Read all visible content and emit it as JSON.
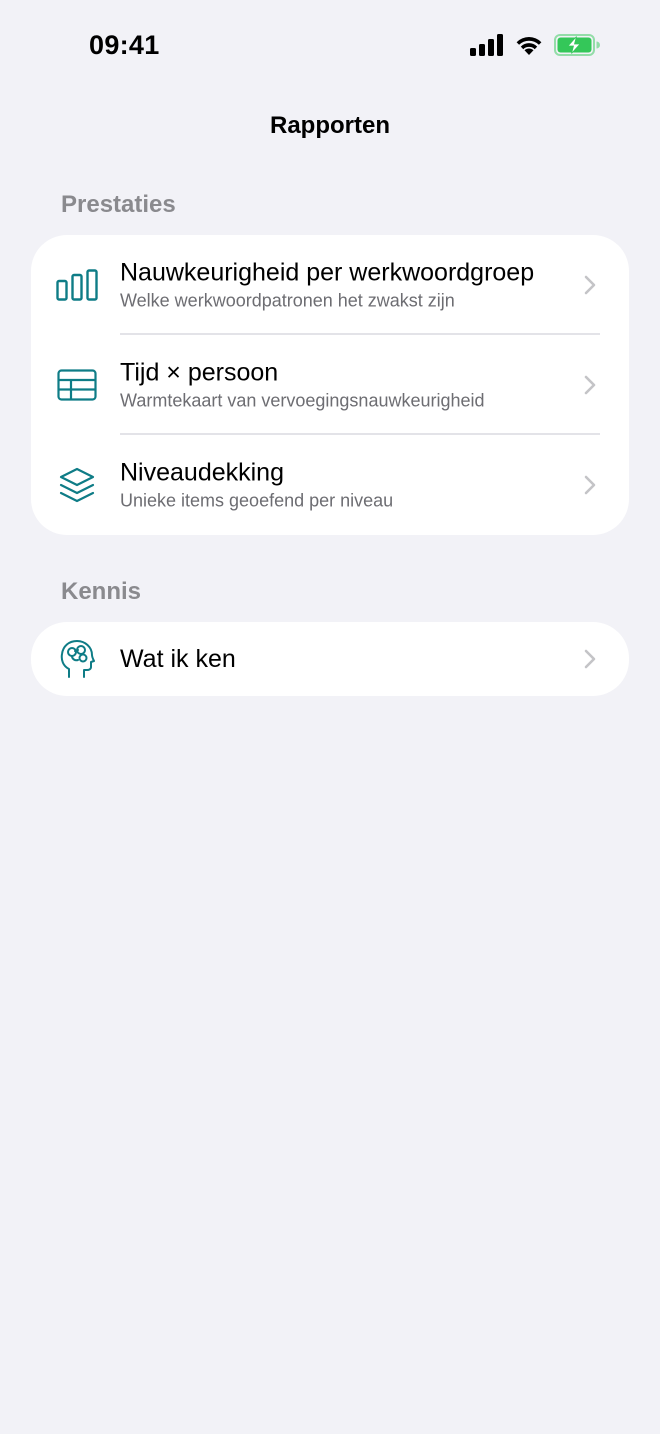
{
  "status_bar": {
    "time": "09:41",
    "icons": [
      "cellular-signal-icon",
      "wifi-icon",
      "battery-charging-icon"
    ],
    "battery_color": "#34C759"
  },
  "nav": {
    "title": "Rapporten"
  },
  "accent_color": "#0E7C86",
  "sections": [
    {
      "header": "Prestaties",
      "items": [
        {
          "icon": "bar-chart-icon",
          "title": "Nauwkeurigheid per werkwoordgroep",
          "subtitle": "Welke werkwoordpatronen het zwakst zijn"
        },
        {
          "icon": "table-grid-icon",
          "title": "Tijd × persoon",
          "subtitle": "Warmtekaart van vervoegingsnauwkeurigheid"
        },
        {
          "icon": "layers-icon",
          "title": "Niveaudekking",
          "subtitle": "Unieke items geoefend per niveau"
        }
      ]
    },
    {
      "header": "Kennis",
      "items": [
        {
          "icon": "brain-head-icon",
          "title": "Wat ik ken"
        }
      ]
    }
  ]
}
